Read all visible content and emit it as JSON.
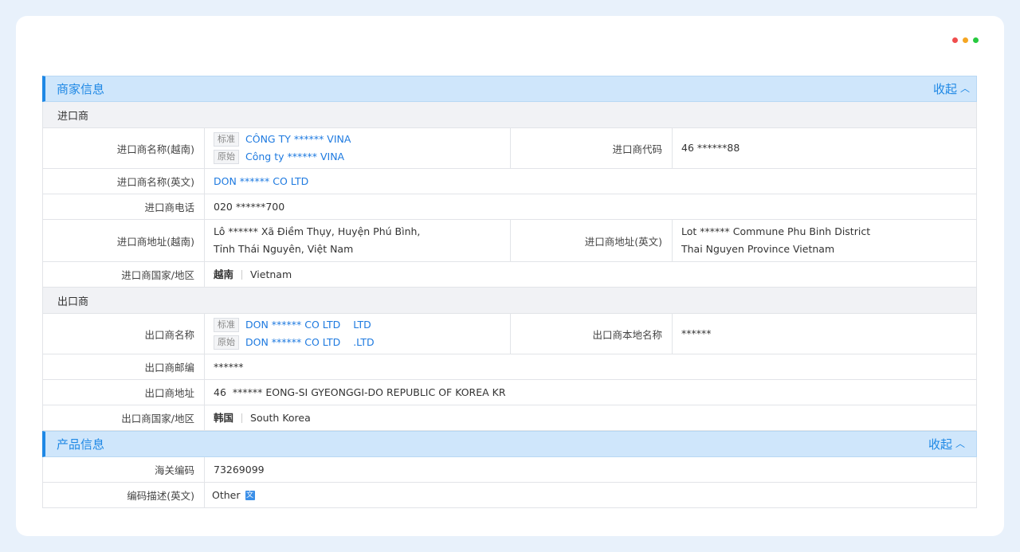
{
  "window": {
    "dot_colors": [
      "#f04d4d",
      "#f5a623",
      "#27c93f"
    ]
  },
  "merchant": {
    "title": "商家信息",
    "collapse_label": "收起",
    "importer": {
      "group": "进口商",
      "name_vn_label": "进口商名称(越南)",
      "name_vn_std_tag": "标准",
      "name_vn_std": "CÔNG TY ****** VINA",
      "name_vn_orig_tag": "原始",
      "name_vn_orig": "Công ty ******  VINA",
      "code_label": "进口商代码",
      "code": "46 ******88",
      "name_en_label": "进口商名称(英文)",
      "name_en": "DON ****** CO LTD",
      "phone_label": "进口商电话",
      "phone": "020 ******700",
      "addr_vn_label": "进口商地址(越南)",
      "addr_vn_1": "Lô ****** Xã Điềm Thụy, Huyện Phú Bình,",
      "addr_vn_2": "Tỉnh Thái Nguyên, Việt Nam",
      "addr_en_label": "进口商地址(英文)",
      "addr_en_1": "Lot ******  Commune Phu Binh District",
      "addr_en_2": "Thai Nguyen Province Vietnam",
      "country_label": "进口商国家/地区",
      "country_cn": "越南",
      "country_en": "Vietnam"
    },
    "exporter": {
      "group": "出口商",
      "name_label": "出口商名称",
      "name_std_tag": "标准",
      "name_std": "DON ****** CO LTD    LTD",
      "name_orig_tag": "原始",
      "name_orig": "DON ****** CO LTD    .LTD",
      "local_name_label": "出口商本地名称",
      "local_name": "******",
      "postal_label": "出口商邮编",
      "postal": "******",
      "addr_label": "出口商地址",
      "addr": "46  ****** EONG-SI GYEONGGI-DO REPUBLIC OF KOREA KR",
      "country_label": "出口商国家/地区",
      "country_cn": "韩国",
      "country_en": "South Korea"
    }
  },
  "product": {
    "title": "产品信息",
    "collapse_label": "收起",
    "hs_label": "海关编码",
    "hs_code": "73269099",
    "desc_label": "编码描述(英文)",
    "desc": "Other",
    "desc_icon": "translate-icon"
  }
}
